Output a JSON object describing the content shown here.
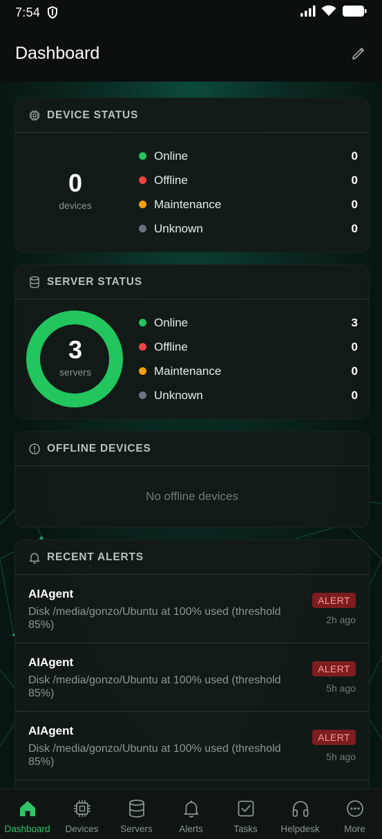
{
  "status_bar": {
    "time": "7:54"
  },
  "header": {
    "title": "Dashboard"
  },
  "device_status": {
    "title": "DEVICE STATUS",
    "count": "0",
    "count_label": "devices",
    "items": [
      {
        "label": "Online",
        "value": "0",
        "color": "#22c55e"
      },
      {
        "label": "Offline",
        "value": "0",
        "color": "#ef4444"
      },
      {
        "label": "Maintenance",
        "value": "0",
        "color": "#f59e0b"
      },
      {
        "label": "Unknown",
        "value": "0",
        "color": "#6b7280"
      }
    ]
  },
  "server_status": {
    "title": "SERVER STATUS",
    "count": "3",
    "count_label": "servers",
    "ring_online_fraction": 1.0,
    "ring_color": "#22c55e",
    "items": [
      {
        "label": "Online",
        "value": "3",
        "color": "#22c55e"
      },
      {
        "label": "Offline",
        "value": "0",
        "color": "#ef4444"
      },
      {
        "label": "Maintenance",
        "value": "0",
        "color": "#f59e0b"
      },
      {
        "label": "Unknown",
        "value": "0",
        "color": "#6b7280"
      }
    ]
  },
  "offline_devices": {
    "title": "OFFLINE DEVICES",
    "empty_text": "No offline devices"
  },
  "recent_alerts": {
    "title": "RECENT ALERTS",
    "items": [
      {
        "source": "AIAgent",
        "message": "Disk /media/gonzo/Ubuntu at 100% used (threshold 85%)",
        "badge": "ALERT",
        "ago": "2h ago"
      },
      {
        "source": "AIAgent",
        "message": "Disk /media/gonzo/Ubuntu at 100% used (threshold 85%)",
        "badge": "ALERT",
        "ago": "5h ago"
      },
      {
        "source": "AIAgent",
        "message": "Disk /media/gonzo/Ubuntu at 100% used (threshold 85%)",
        "badge": "ALERT",
        "ago": "5h ago"
      }
    ]
  },
  "tabs": [
    {
      "label": "Dashboard",
      "icon": "home-icon",
      "active": true
    },
    {
      "label": "Devices",
      "icon": "chip-icon",
      "active": false
    },
    {
      "label": "Servers",
      "icon": "database-icon",
      "active": false
    },
    {
      "label": "Alerts",
      "icon": "bell-icon",
      "active": false
    },
    {
      "label": "Tasks",
      "icon": "checkbox-icon",
      "active": false
    },
    {
      "label": "Helpdesk",
      "icon": "headset-icon",
      "active": false
    },
    {
      "label": "More",
      "icon": "more-icon",
      "active": false
    }
  ],
  "colors": {
    "accent": "#2fc46a",
    "background": "#081613",
    "card": "#121a17"
  }
}
